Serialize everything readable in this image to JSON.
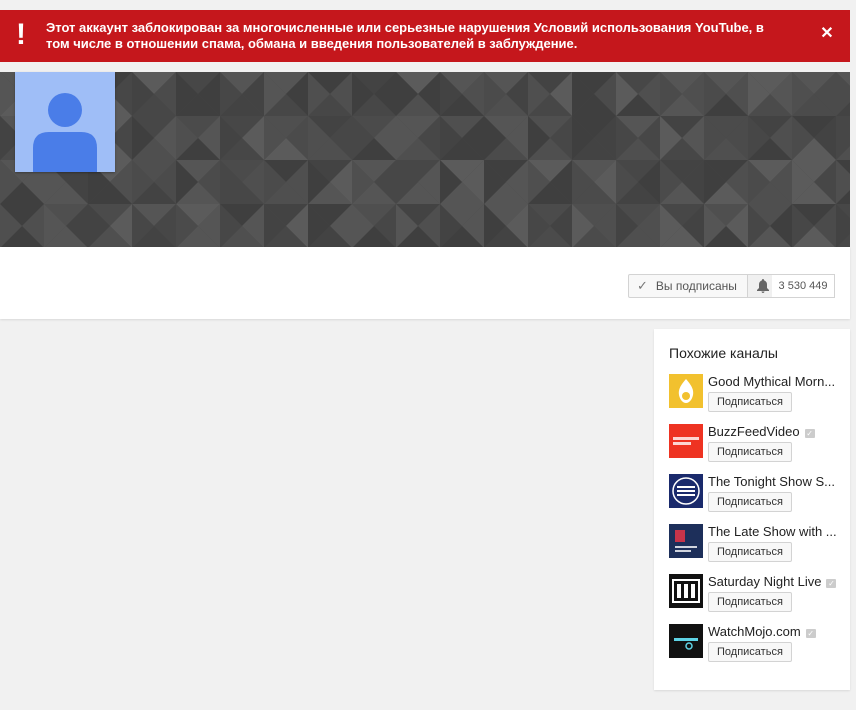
{
  "alert": {
    "message": "Этот аккаунт заблокирован за многочисленные или серьезные нарушения Условий использования YouTube, в том числе в отношении спама, обмана и введения пользователей в заблуждение.",
    "icon": "exclamation-icon",
    "close_icon": "close-icon",
    "color": "#c5171c"
  },
  "channel": {
    "subscribed_label": "Вы подписаны",
    "subscriber_count": "3 530 449"
  },
  "related": {
    "title": "Похожие каналы",
    "subscribe_label": "Подписаться",
    "channels": [
      {
        "name": "Good Mythical Morn...",
        "verified": false,
        "thumb_color": "#f2c12e"
      },
      {
        "name": "BuzzFeedVideo",
        "verified": true,
        "thumb_color": "#ee3322"
      },
      {
        "name": "The Tonight Show S...",
        "verified": false,
        "thumb_color": "#1a2a6c"
      },
      {
        "name": "The Late Show with ...",
        "verified": false,
        "thumb_color": "#1d2f5a"
      },
      {
        "name": "Saturday Night Live",
        "verified": true,
        "thumb_color": "#111111"
      },
      {
        "name": "WatchMojo.com",
        "verified": true,
        "thumb_color": "#111111"
      }
    ]
  }
}
